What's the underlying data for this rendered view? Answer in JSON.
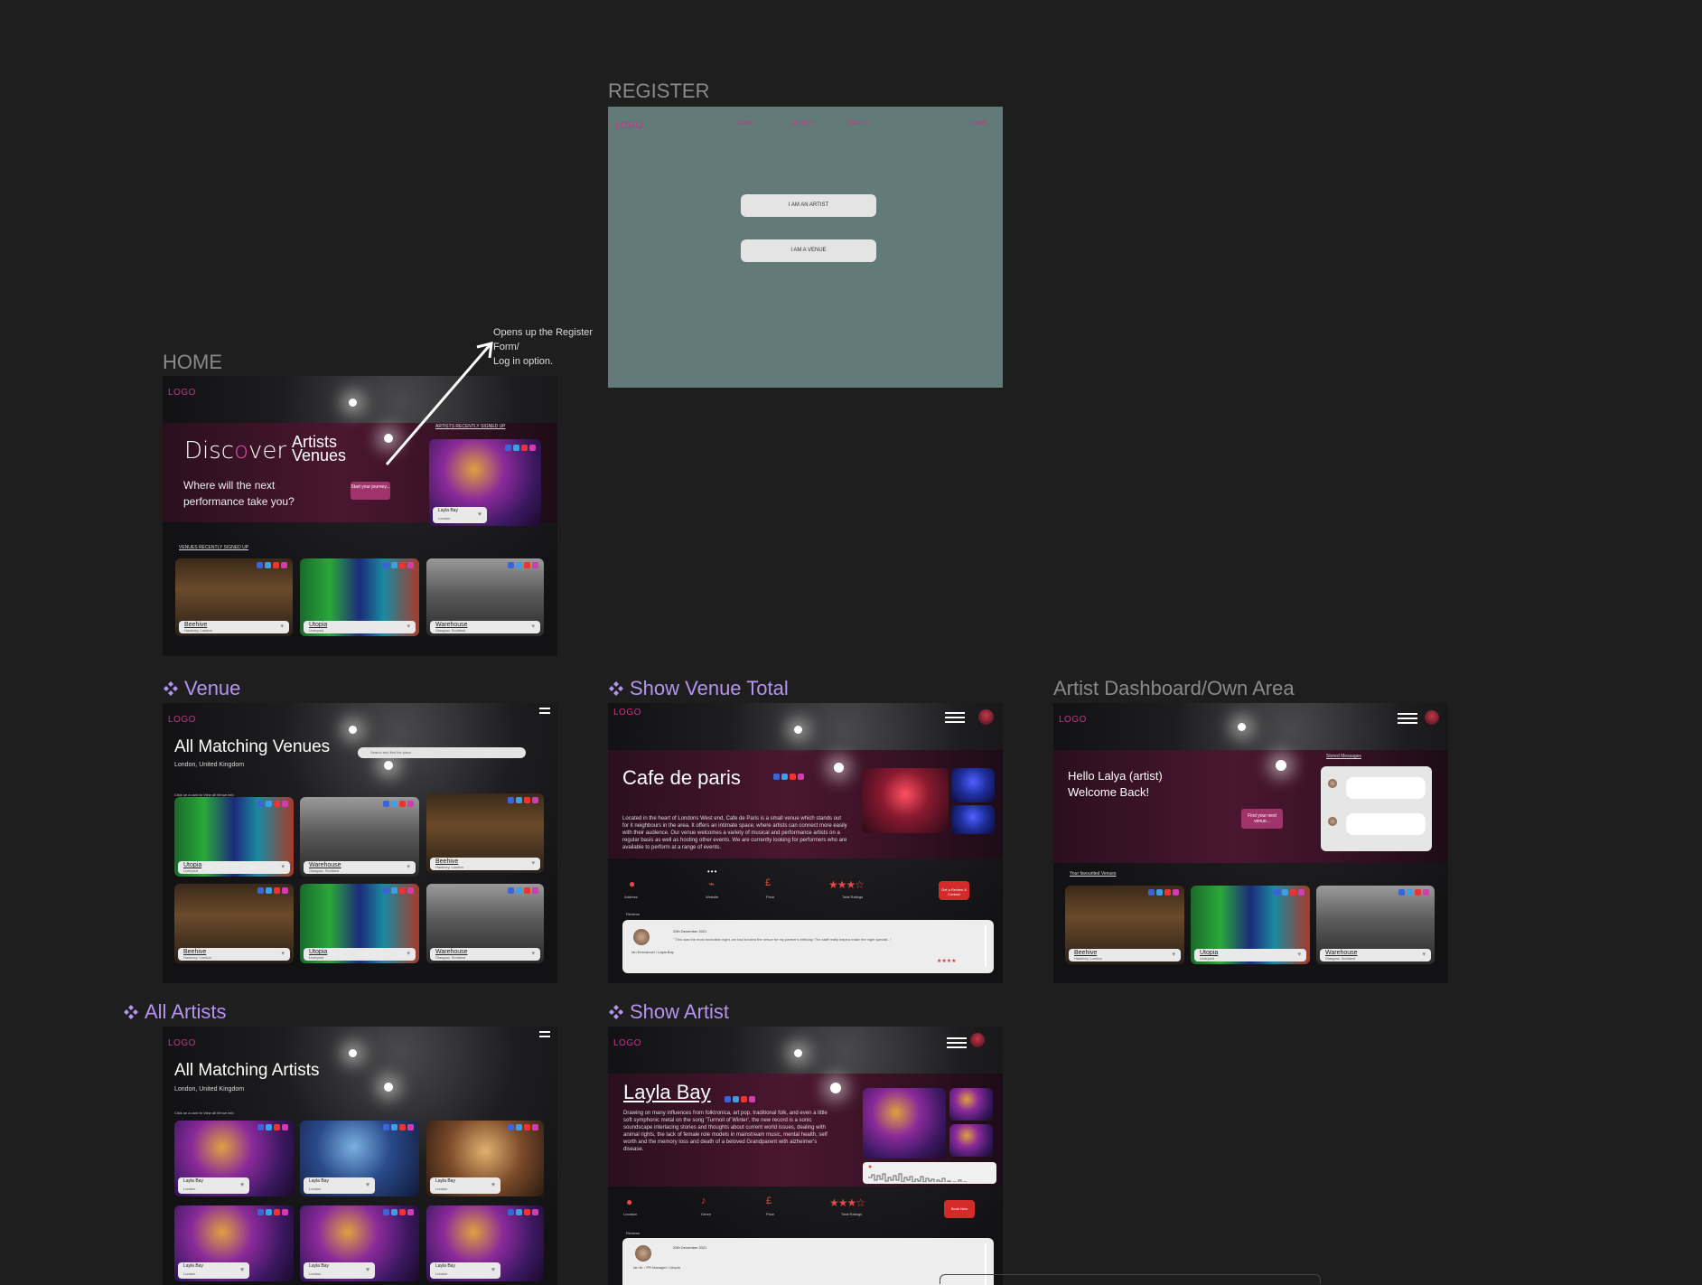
{
  "frames": {
    "register": {
      "label": "REGISTER",
      "logo": "LOGO",
      "nav": [
        "HOME",
        "ARTISTS",
        "VENUES",
        "LOGIN"
      ],
      "btn_artist": "I AM AN ARTIST",
      "btn_venue": "I AM A VENUE"
    },
    "home": {
      "label": "HOME",
      "logo": "LOGO",
      "discover_pre": "Disc",
      "discover_o": "o",
      "discover_post": "ver",
      "artists_word": "Artists",
      "venues_word": "Venues",
      "tagline_1": "Where will the next",
      "tagline_2": "performance take you?",
      "cta": "Start your journey...",
      "artists_recent": "ARTISTS RECENTLY SIGNED UP",
      "venues_recent": "VENUES RECENTLY SIGNED UP",
      "featured_artist": {
        "name": "Layla Bay",
        "loc": "London"
      },
      "venues": [
        {
          "name": "Beehive",
          "loc": "Hackney, London"
        },
        {
          "name": "Utopia",
          "loc": "Liverpool"
        },
        {
          "name": "Warehouse",
          "loc": "Glasgow, Scotland"
        }
      ]
    },
    "annotation": {
      "line1": "Opens up the Register",
      "line2": "Form/",
      "line3": "Log in option."
    },
    "venue": {
      "label": "Venue",
      "logo": "LOGO",
      "title": "All Matching Venues",
      "subtitle": "London, United Kingdom",
      "search_placeholder": "Search and find the place",
      "hint": "Click on a card to View all Venue info",
      "cards": [
        {
          "name": "Utopia",
          "loc": "Liverpool"
        },
        {
          "name": "Warehouse",
          "loc": "Glasgow, Scotland"
        },
        {
          "name": "Beehive",
          "loc": "Hackney, London"
        },
        {
          "name": "Beehive",
          "loc": "Hackney, London"
        },
        {
          "name": "Utopia",
          "loc": "Liverpool"
        },
        {
          "name": "Warehouse",
          "loc": "Glasgow, Scotland"
        }
      ]
    },
    "show_venue": {
      "label": "Show Venue Total",
      "logo": "LOGO",
      "title": "Cafe de paris",
      "description": "Located in the heart of Londons West end, Cafe de Paris is a small venue which stands out for it neighbours in the area. It offers an intimate space, where artists can connect more easily with their audience. Our venue welcomes a variety of musical and performance artists on a regular basis as well as hosting other events. We are currently looking for performers who are available to perform at a range of events.",
      "info_labels": [
        "Address",
        "Website",
        "Price"
      ],
      "ratings_label": "Total Ratings",
      "book_btn": "Get a Review & Contact",
      "reviews_label": "Reviews",
      "review_date": "20th December 2021",
      "review_author": "Ian Emmanuel / Layla Bay",
      "review_text": "\" This was the most incredible night, we had booked the venue for my partner's birthday. The staff really helped make the night special...\""
    },
    "dashboard": {
      "label": "Artist Dashboard/Own Area",
      "logo": "LOGO",
      "hello_1": "Hello Lalya (artist)",
      "hello_2": "Welcome Back!",
      "stored_messages": "Stored Messages",
      "cta": "Find your next venue...",
      "fav_venues": "Your favourited Venues",
      "venues": [
        {
          "name": "Beehive",
          "loc": "Hackney, London"
        },
        {
          "name": "Utopia",
          "loc": "Liverpool"
        },
        {
          "name": "Warehouse",
          "loc": "Glasgow, Scotland"
        }
      ]
    },
    "all_artists": {
      "label": "All Artists",
      "logo": "LOGO",
      "title": "All Matching Artists",
      "subtitle": "London, United Kingdom",
      "hint": "Click on a card to View all Venue info",
      "cards": [
        {
          "name": "Layla Bay",
          "loc": "London"
        },
        {
          "name": "Layla Bay",
          "loc": "London"
        },
        {
          "name": "Layla Bay",
          "loc": "London"
        },
        {
          "name": "Layla Bay",
          "loc": "London"
        },
        {
          "name": "Layla Bay",
          "loc": "London"
        },
        {
          "name": "Layla Bay",
          "loc": "London"
        }
      ]
    },
    "show_artist": {
      "label": "Show Artist",
      "logo": "LOGO",
      "title": "Layla Bay",
      "description": "Drawing on many influences from folktronica, art pop, traditional folk, and even a little soft symphonic metal on the song 'Turmoil of Winter', the new record is a sonic soundscape interlacing stories and thoughts about current world issues, dealing with animal rights, the lack of female role models in mainstream music, mental health, self worth and the memory loss and death of a beloved Grandparent with alzheimer's disease.",
      "info_labels": [
        "Location",
        "Genre",
        "Price"
      ],
      "ratings_label": "Total Ratings",
      "book_btn": "Book Now",
      "reviews_label": "Reviews",
      "review_date": "20th December 2021",
      "review_author": "Ian M. / PR Manager / Utopia"
    }
  },
  "colors": {
    "canvas": "#1e1e1e",
    "accent": "#c2378b",
    "component": "#b593f0",
    "register_bg": "#627a78"
  }
}
